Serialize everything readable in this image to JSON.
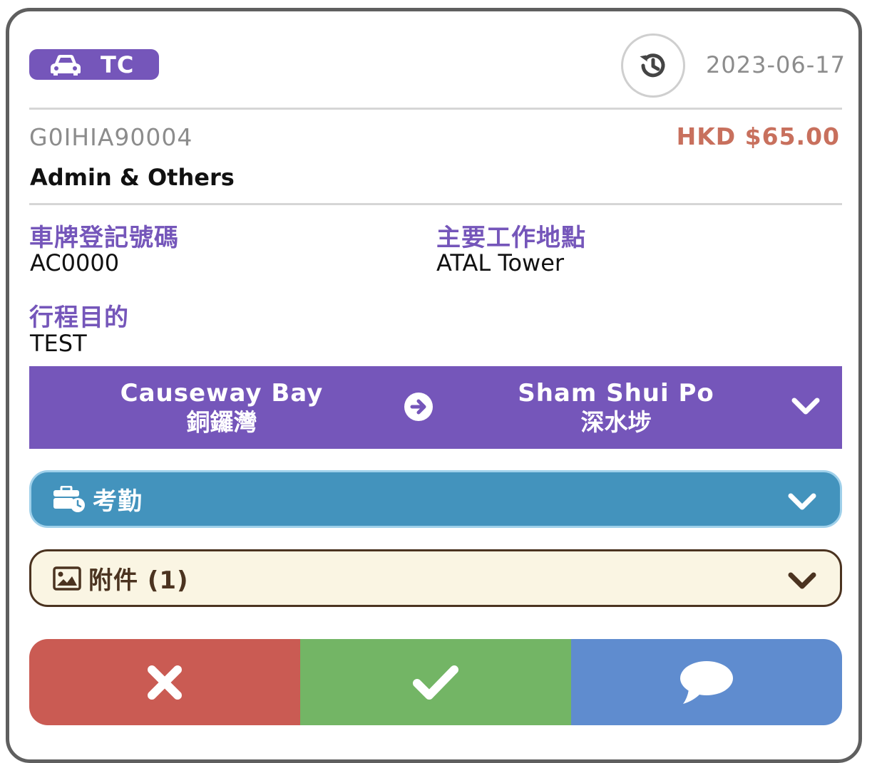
{
  "header": {
    "badge_label": "TC",
    "badge_icon": "car-icon",
    "history_icon": "history-icon",
    "date": "2023-06-17"
  },
  "summary": {
    "code": "G0IHIA90004",
    "amount": "HKD $65.00",
    "category": "Admin & Others"
  },
  "fields": {
    "plate_label": "車牌登記號碼",
    "plate_value": "AC0000",
    "location_label": "主要工作地點",
    "location_value": "ATAL Tower",
    "purpose_label": "行程目的",
    "purpose_value": "TEST"
  },
  "route": {
    "from_en": "Causeway Bay",
    "from_zh": "銅鑼灣",
    "to_en": "Sham Shui Po",
    "to_zh": "深水埗"
  },
  "attendance": {
    "label": "考勤",
    "icon": "briefcase-clock-icon"
  },
  "attachments": {
    "label": "附件 (1)",
    "icon": "image-icon"
  },
  "actions": {
    "reject_icon": "close-icon",
    "approve_icon": "check-icon",
    "comment_icon": "comment-icon"
  },
  "colors": {
    "primary": "#7556ba",
    "amount": "#c8705d",
    "attendance": "#4393bd",
    "attachment_bg": "#faf5e3",
    "reject": "#ca5b53",
    "approve": "#73b565",
    "comment": "#5f8ccf"
  }
}
